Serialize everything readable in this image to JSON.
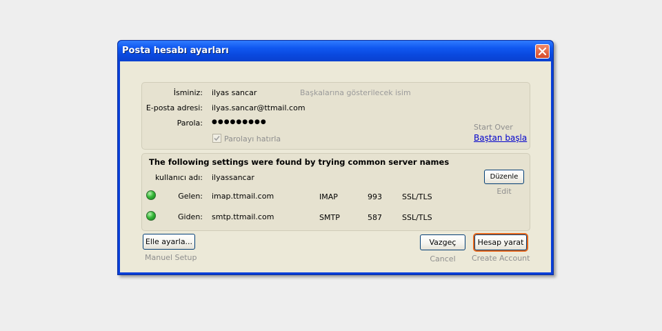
{
  "window": {
    "title": "Posta hesabı ayarları"
  },
  "account": {
    "name_label": "İsminiz:",
    "name_value": "ilyas sancar",
    "name_hint": "Başkalarına gösterilecek isim",
    "email_label": "E-posta adresi:",
    "email_value": "ilyas.sancar@ttmail.com",
    "password_label": "Parola:",
    "password_value": "●●●●●●●●●",
    "remember_label": "Parolayı hatırla",
    "remember_checked": true,
    "start_over_caption": "Start Over",
    "start_over_link": "Baştan başla"
  },
  "servers": {
    "heading": "The following settings were found by trying common server names",
    "username_label": "kullanıcı adı:",
    "username_value": "ilyassancar",
    "edit_button": "Düzenle",
    "edit_caption": "Edit",
    "incoming": {
      "label": "Gelen:",
      "host": "imap.ttmail.com",
      "protocol": "IMAP",
      "port": "993",
      "security": "SSL/TLS",
      "status_color": "#2fae35"
    },
    "outgoing": {
      "label": "Giden:",
      "host": "smtp.ttmail.com",
      "protocol": "SMTP",
      "port": "587",
      "security": "SSL/TLS",
      "status_color": "#2fae35"
    }
  },
  "footer": {
    "manual_button": "Elle ayarla...",
    "manual_caption": "Manuel Setup",
    "cancel_button": "Vazgeç",
    "cancel_caption": "Cancel",
    "create_button": "Hesap yarat",
    "create_caption": "Create Account"
  },
  "colors": {
    "accent": "#e7661a",
    "titlebar": "#0a48de",
    "link": "#0000cc"
  }
}
